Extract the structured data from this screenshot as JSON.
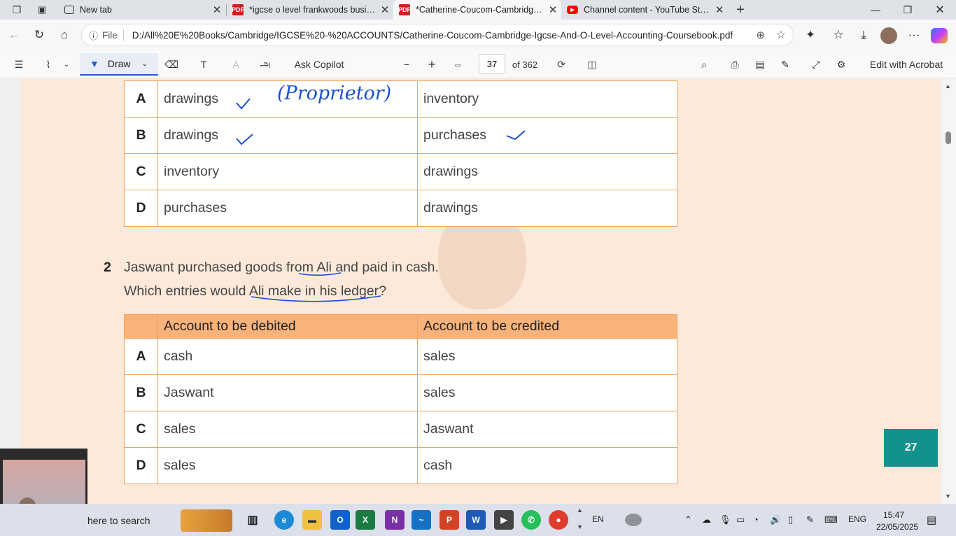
{
  "tabs": [
    {
      "title": "New tab"
    },
    {
      "title": "*igcse o level frankwoods business"
    },
    {
      "title": "*Catherine-Coucom-Cambridge-Igcse"
    },
    {
      "title": "Channel content - YouTube Studio"
    }
  ],
  "address": {
    "file_label": "File",
    "url": "D:/All%20E%20Books/Cambridge/IGCSE%20-%20ACCOUNTS/Catherine-Coucom-Cambridge-Igcse-And-O-Level-Accounting-Coursebook.pdf"
  },
  "pdf_toolbar": {
    "draw": "Draw",
    "ask_copilot": "Ask Copilot",
    "page_current": "37",
    "page_total": "of 362",
    "edit_acrobat": "Edit with Acrobat"
  },
  "table1": {
    "rows": [
      {
        "key": "A",
        "debit": "drawings",
        "credit": "inventory"
      },
      {
        "key": "B",
        "debit": "drawings",
        "credit": "purchases"
      },
      {
        "key": "C",
        "debit": "inventory",
        "credit": "drawings"
      },
      {
        "key": "D",
        "debit": "purchases",
        "credit": "drawings"
      }
    ]
  },
  "annotation": {
    "proprietor": "(Proprietor)"
  },
  "question2": {
    "number": "2",
    "line1_a": "Jaswant purchased goods ",
    "line1_b": "from Ali",
    "line1_c": " and paid in cash.",
    "line2_a": "Which entries would ",
    "line2_b": "Ali make in his ledger",
    "line2_c": "?"
  },
  "table2": {
    "header_debit": "Account to be debited",
    "header_credit": "Account to be credited",
    "rows": [
      {
        "key": "A",
        "debit": "cash",
        "credit": "sales"
      },
      {
        "key": "B",
        "debit": "Jaswant",
        "credit": "sales"
      },
      {
        "key": "C",
        "debit": "sales",
        "credit": "Jaswant"
      },
      {
        "key": "D",
        "debit": "sales",
        "credit": "cash"
      }
    ]
  },
  "page_number": "27",
  "taskbar": {
    "search": "here to search",
    "lang1": "EN",
    "lang2": "ENG",
    "time": "15:47",
    "date": "22/05/2025"
  },
  "colors": {
    "accent_teal": "#13918c",
    "table_border": "#f3a15c",
    "header_fill": "#f9b27a",
    "ink": "#1a4fd0"
  }
}
